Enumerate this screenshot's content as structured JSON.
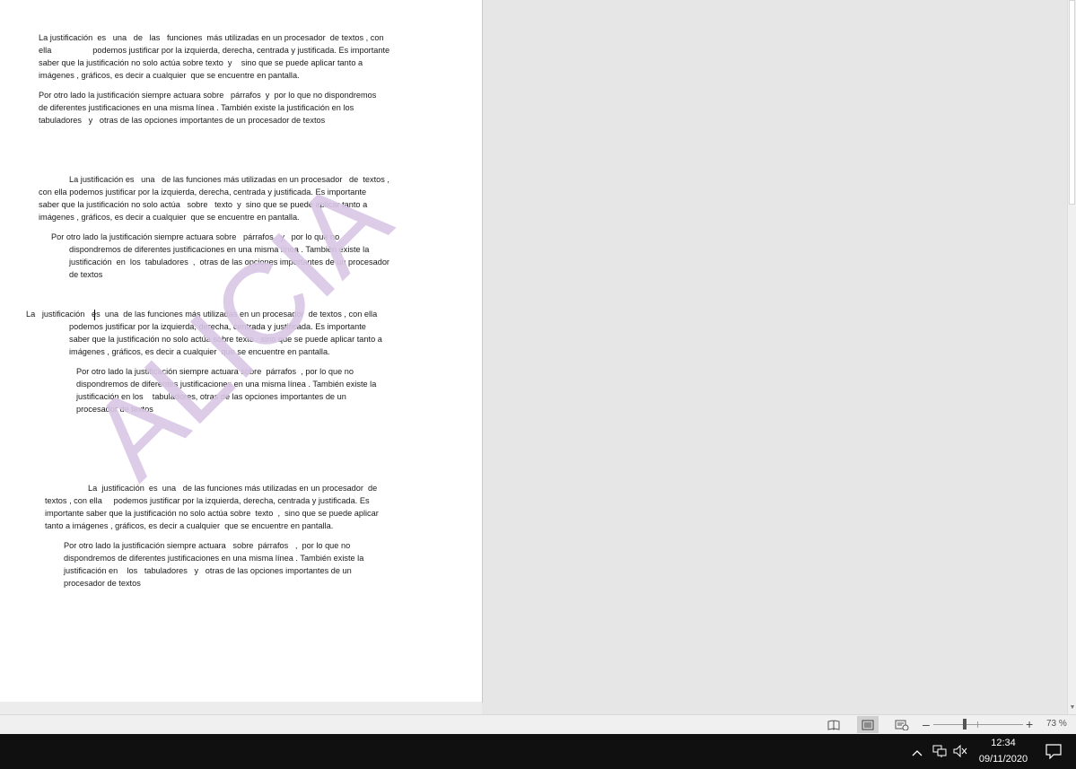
{
  "document": {
    "watermark": "ALICIA",
    "block1": {
      "p1": [
        "La justificación  es   una   de   las   funciones  más utilizadas en un procesador  de textos , con",
        "ella                  podemos justificar por la izquierda, derecha, centrada y justificada. Es importante",
        "saber que la justificación no solo actúa sobre texto  y    sino que se puede aplicar tanto a",
        "imágenes , gráficos, es decir a cualquier  que se encuentre en pantalla."
      ],
      "p2": [
        "Por otro lado la justificación siempre actuara sobre   párrafos  y  por lo que no dispondremos",
        "de diferentes justificaciones en una misma línea . También existe la justificación en los",
        "tabuladores   y   otras de las opciones importantes de un procesador de textos"
      ]
    },
    "block2": {
      "p1": [
        "La justificación es   una   de las funciones más utilizadas en un procesador   de  textos ,",
        "con ella podemos justificar por la izquierda, derecha, centrada y justificada. Es importante",
        "saber que la justificación no solo actúa   sobre   texto  y  sino que se puede aplicar tanto a",
        "imágenes , gráficos, es decir a cualquier  que se encuentre en pantalla."
      ],
      "p2_first": "Por otro lado la justificación siempre actuara sobre   párrafos   y   por lo que no",
      "p2_rest": [
        "dispondremos de diferentes justificaciones en una misma línea . También existe la",
        "justificación  en  los  tabuladores  ,  otras de las opciones importantes de un procesador",
        "de textos"
      ]
    },
    "block3": {
      "p1_first": "La   justificación   es  una  de las funciones más utilizadas en un procesador  de textos , con ella",
      "p1_rest": [
        "podemos justificar por la izquierda, derecha, centrada y justificada. Es importante",
        "saber que la justificación no solo actúa sobre texto   sino que se puede aplicar tanto a",
        "imágenes , gráficos, es decir a cualquier  que se encuentre en pantalla."
      ],
      "p2": [
        "Por otro lado la justificación siempre actuara sobre  párrafos  , por lo que no",
        "dispondremos de diferentes justificaciones en una misma línea . También existe la",
        "justificación en los    tabuladores, otras de las opciones importantes de un",
        "procesador de textos"
      ]
    },
    "block4": {
      "p1": [
        "La  justificación  es  una   de las funciones más utilizadas en un procesador  de",
        "textos , con ella     podemos justificar por la izquierda, derecha, centrada y justificada. Es",
        "importante saber que la justificación no solo actúa sobre  texto  ,  sino que se puede aplicar",
        "tanto a imágenes , gráficos, es decir a cualquier  que se encuentre en pantalla."
      ],
      "p2": [
        "Por otro lado la justificación siempre actuara   sobre  párrafos   ,  por lo que no",
        "dispondremos de diferentes justificaciones en una misma línea . También existe la",
        "justificación en    los   tabuladores   y   otras de las opciones importantes de un",
        "procesador de textos"
      ]
    }
  },
  "statusbar": {
    "zoom_minus": "–",
    "zoom_plus": "+",
    "zoom_level": "73 %",
    "zoom_value": 73
  },
  "taskbar": {
    "time": "12:34",
    "date": "09/11/2020"
  },
  "colors": {
    "watermark": "#d9c6e6",
    "page": "#ffffff",
    "workspace": "#e6e6e6",
    "taskbar": "#101010"
  }
}
